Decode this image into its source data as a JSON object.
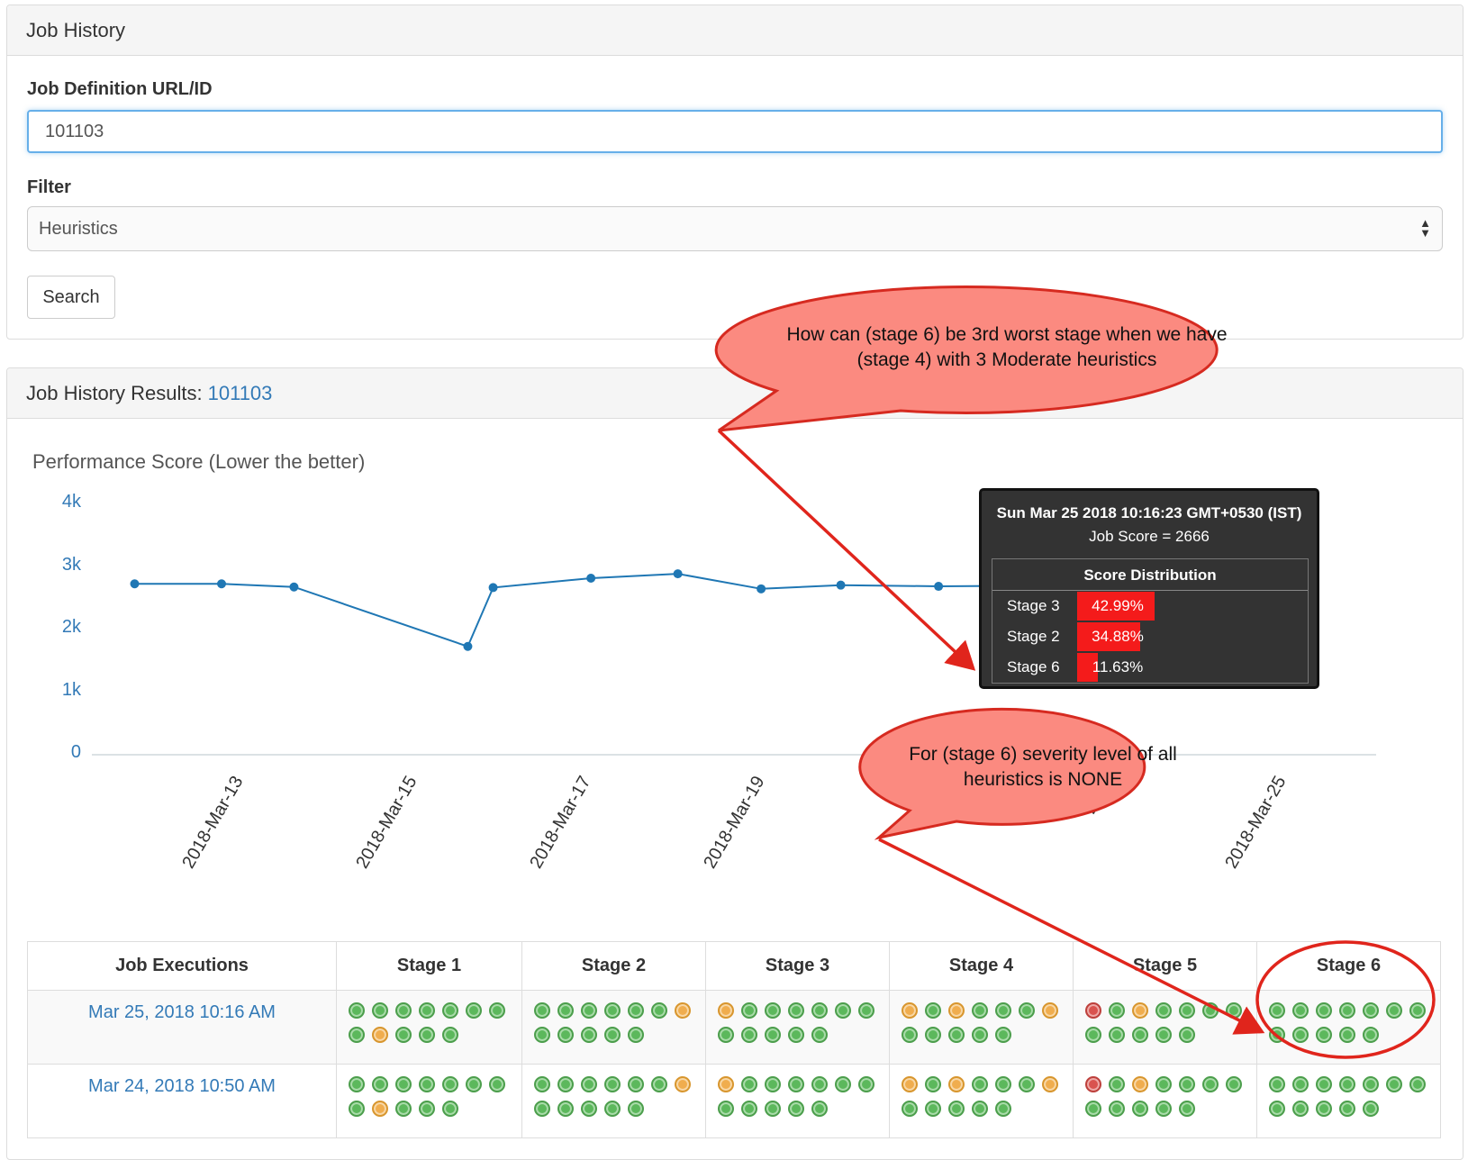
{
  "job_history": {
    "title": "Job History"
  },
  "form": {
    "url_label": "Job Definition URL/ID",
    "url_value": "101103",
    "filter_label": "Filter",
    "filter_value": "Heuristics",
    "search_label": "Search"
  },
  "results": {
    "title": "Job History Results:",
    "job_id": "101103"
  },
  "chart_data": {
    "type": "line",
    "title": "Performance Score (Lower the better)",
    "y_ticks": [
      "4k",
      "3k",
      "2k",
      "1k",
      "0"
    ],
    "ylim": [
      0,
      4000
    ],
    "x_tick_labels": [
      "2018-Mar-13",
      "2018-Mar-15",
      "2018-Mar-17",
      "2018-Mar-19",
      "2018",
      "2018",
      "2018-Mar-25"
    ],
    "x_tick_dates": [
      "2018-03-13",
      "2018-03-15",
      "2018-03-17",
      "2018-03-19",
      "2018-03-21",
      "2018-03-23",
      "2018-03-25"
    ],
    "series": [
      {
        "x": [
          "2018-03-12T00:00",
          "2018-03-13T00:00",
          "2018-03-13T20:00",
          "2018-03-15T20:00",
          "2018-03-16T03:00",
          "2018-03-17T06:00",
          "2018-03-18T06:00",
          "2018-03-19T05:00",
          "2018-03-20T03:00",
          "2018-03-21T06:00",
          "2018-03-22T06:00",
          "2018-03-23T04:00",
          "2018-03-24T10:50",
          "2018-03-25T10:16"
        ],
        "y": [
          2730,
          2730,
          2680,
          1730,
          2670,
          2820,
          2890,
          2650,
          2710,
          2690,
          2700,
          2680,
          2620,
          2666
        ]
      }
    ],
    "highlight_index": 13,
    "grid": false
  },
  "tooltip": {
    "title": "Sun Mar 25 2018 10:16:23 GMT+0530 (IST)",
    "score": "Job Score = 2666",
    "dist_title": "Score Distribution",
    "rows": [
      {
        "label": "Stage 3",
        "pct_text": "42.99%",
        "value": 42.99
      },
      {
        "label": "Stage 2",
        "pct_text": "34.88%",
        "value": 34.88
      },
      {
        "label": "Stage 6",
        "pct_text": "11.63%",
        "value": 11.63
      }
    ]
  },
  "annotations": {
    "callout1": "How can (stage 6) be 3rd worst stage when we have (stage 4) with 3 Moderate heuristics",
    "callout2": "For (stage 6) severity level of all heuristics is NONE",
    "callout_color": "#fb8a80",
    "arrow_color": "#e0251c"
  },
  "table": {
    "headers": [
      "Job Executions",
      "Stage 1",
      "Stage 2",
      "Stage 3",
      "Stage 4",
      "Stage 5",
      "Stage 6"
    ],
    "rows": [
      {
        "label": "Mar 25, 2018 10:16 AM",
        "stages": [
          [
            "green",
            "green",
            "green",
            "green",
            "green",
            "green",
            "green",
            "green",
            "orange",
            "green",
            "green",
            "green"
          ],
          [
            "green",
            "green",
            "green",
            "green",
            "green",
            "green",
            "orange",
            "green",
            "green",
            "green",
            "green",
            "green"
          ],
          [
            "orange",
            "green",
            "green",
            "green",
            "green",
            "green",
            "green",
            "green",
            "green",
            "green",
            "green",
            "green"
          ],
          [
            "orange",
            "green",
            "orange",
            "green",
            "green",
            "green",
            "orange",
            "green",
            "green",
            "green",
            "green",
            "green"
          ],
          [
            "red",
            "green",
            "orange",
            "green",
            "green",
            "green",
            "green",
            "green",
            "green",
            "green",
            "green",
            "green"
          ],
          [
            "green",
            "green",
            "green",
            "green",
            "green",
            "green",
            "green",
            "green",
            "green",
            "green",
            "green",
            "green"
          ]
        ]
      },
      {
        "label": "Mar 24, 2018 10:50 AM",
        "stages": [
          [
            "green",
            "green",
            "green",
            "green",
            "green",
            "green",
            "green",
            "green",
            "orange",
            "green",
            "green",
            "green"
          ],
          [
            "green",
            "green",
            "green",
            "green",
            "green",
            "green",
            "orange",
            "green",
            "green",
            "green",
            "green",
            "green"
          ],
          [
            "orange",
            "green",
            "green",
            "green",
            "green",
            "green",
            "green",
            "green",
            "green",
            "green",
            "green",
            "green"
          ],
          [
            "orange",
            "green",
            "orange",
            "green",
            "green",
            "green",
            "orange",
            "green",
            "green",
            "green",
            "green",
            "green"
          ],
          [
            "red",
            "green",
            "orange",
            "green",
            "green",
            "green",
            "green",
            "green",
            "green",
            "green",
            "green",
            "green"
          ],
          [
            "green",
            "green",
            "green",
            "green",
            "green",
            "green",
            "green",
            "green",
            "green",
            "green",
            "green",
            "green"
          ]
        ]
      }
    ]
  },
  "colors": {
    "line": "#1f77b4",
    "link": "#337ab7",
    "bar": "#f41b1b"
  }
}
